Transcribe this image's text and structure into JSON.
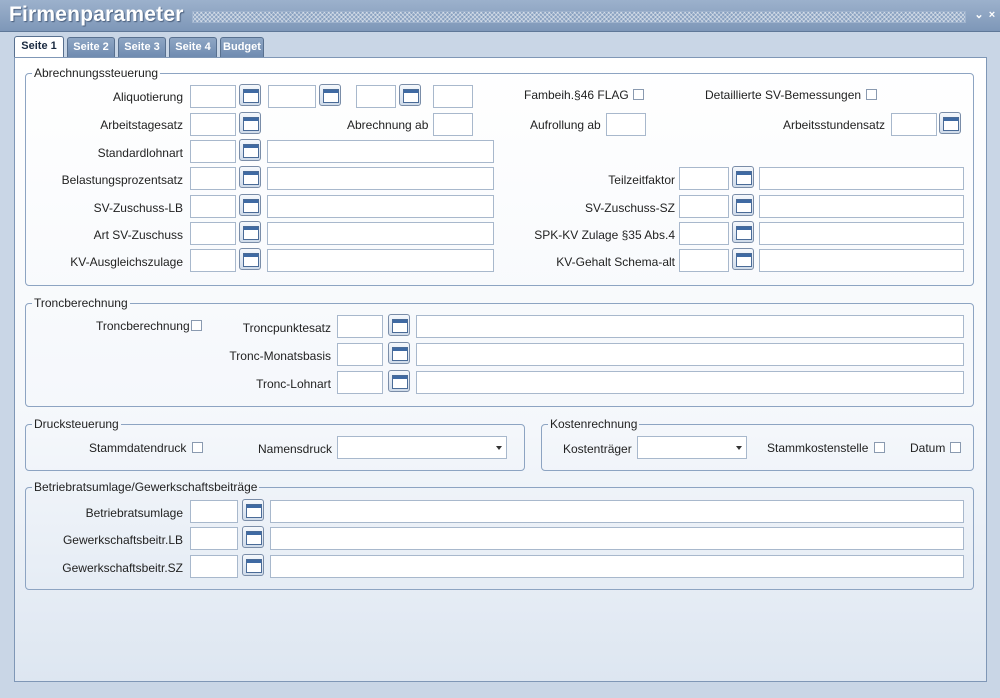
{
  "window": {
    "title": "Firmenparameter",
    "min_glyph": "⌄",
    "close_glyph": "×"
  },
  "tabs": [
    "Seite 1",
    "Seite 2",
    "Seite 3",
    "Seite 4",
    "Budget"
  ],
  "active_tab": "Seite 1",
  "abrechnung": {
    "legend": "Abrechnungssteuerung",
    "aliquotierung": "Aliquotierung",
    "fambeih": "Fambeih.§46 FLAG",
    "detaillierte": "Detaillierte SV-Bemessungen",
    "arbeitstagesatz": "Arbeitstagesatz",
    "abrechnung_ab": "Abrechnung ab",
    "aufrollung_ab": "Aufrollung ab",
    "arbeitsstundensatz": "Arbeitsstundensatz",
    "standardlohnart": "Standardlohnart",
    "belastungsprozentsatz": "Belastungsprozentsatz",
    "teilzeitfaktor": "Teilzeitfaktor",
    "sv_zuschuss_lb": "SV-Zuschuss-LB",
    "sv_zuschuss_sz": "SV-Zuschuss-SZ",
    "art_sv_zuschuss": "Art SV-Zuschuss",
    "spk_kv_zulage": "SPK-KV Zulage §35 Abs.4",
    "kv_ausgleichszulage": "KV-Ausgleichszulage",
    "kv_gehalt": "KV-Gehalt Schema-alt"
  },
  "tronc": {
    "legend": "Troncberechnung",
    "troncberechnung": "Troncberechnung",
    "troncpunktesatz": "Troncpunktesatz",
    "tronc_monatsbasis": "Tronc-Monatsbasis",
    "tronc_lohnart": "Tronc-Lohnart"
  },
  "druck": {
    "legend": "Drucksteuerung",
    "stammdatendruck": "Stammdatendruck",
    "namensdruck": "Namensdruck",
    "namensdruck_value": ""
  },
  "kosten": {
    "legend": "Kostenrechnung",
    "kostentraeger": "Kostenträger",
    "kostentraeger_value": "",
    "stammkostenstelle": "Stammkostenstelle",
    "datum": "Datum"
  },
  "betrieb": {
    "legend": "Betriebratsumlage/Gewerkschaftsbeiträge",
    "betriebratsumlage": "Betriebratsumlage",
    "gewerkschaft_lb": "Gewerkschaftsbeitr.LB",
    "gewerkschaft_sz": "Gewerkschaftsbeitr.SZ"
  },
  "icons": {
    "calendar": "calendar-icon",
    "dropdown": "chevron-down-icon"
  }
}
